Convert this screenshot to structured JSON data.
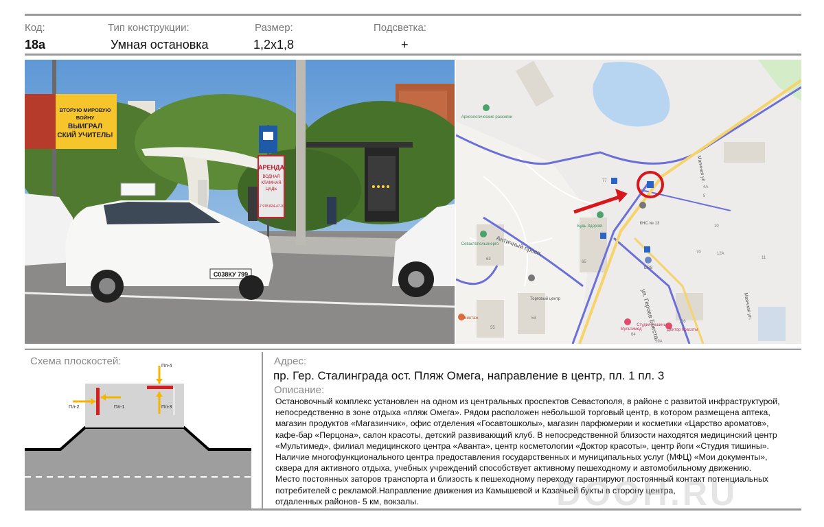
{
  "header": {
    "code_label": "Код:",
    "code_value": "18а",
    "type_label": "Тип конструкции:",
    "type_value": "Умная остановка",
    "size_label": "Размер:",
    "size_value": "1,2х1,8",
    "light_label": "Подсветка:",
    "light_value": "+"
  },
  "photo": {
    "billboard_lines": [
      "ВТОРУЮ МИРОВУЮ",
      "ВОЙНУ",
      "ВЫИГРАЛ",
      "СКИЙ УЧИТЕЛЬ!"
    ],
    "shelter_ad_lines": [
      "АРЕНДА",
      "ВОДНАЯ",
      "КЛАМНАЯ",
      "ЦАДЬ"
    ],
    "shelter_ad_phone": "+7 978 824-47-01",
    "plate_text": "С038КУ 799"
  },
  "map": {
    "street_1": "Античный просп.",
    "street_2": "ул. Героев Бреста",
    "street_3": "Маячная ул.",
    "street_4": "Маячная ул.",
    "poi_1": "Археологические раскопки",
    "poi_2": "Будь Здоров!",
    "poi_3": "КНС № 13",
    "poi_4": "Севастопольэнерго",
    "poi_5": "Торговый центр",
    "poi_6": "CRS",
    "poi_7": "Студия тишины",
    "poi_8": "Мультимед",
    "poi_9": "Доктор Красоты",
    "poi_10": "Винтаж",
    "num_1": "63",
    "num_2": "65",
    "num_3": "53",
    "num_4": "55",
    "num_5": "70",
    "num_6": "10",
    "num_7": "12А",
    "num_8": "11",
    "num_9": "116",
    "num_10": "64",
    "num_11": "59А",
    "num_12": "4А",
    "num_13": "5",
    "num_14": "77"
  },
  "scheme": {
    "title": "Схема плоскостей:",
    "pl1": "Пл-1",
    "pl2": "Пл-2",
    "pl3": "Пл-3",
    "pl4": "Пл-4"
  },
  "address": {
    "label": "Адрес:",
    "value": "пр. Гер. Сталинграда ост. Пляж Омега, направление в центр, пл. 1 пл. 3",
    "desc_label": "Описание:",
    "desc_lines": [
      "Остановочный комплекс установлен на одном из центральных проспектов Севастополя, в районе с развитой инфраструктурой,",
      "непосредственно в зоне отдыха  «пляж Омега». Рядом расположен небольшой торговый центр, в котором размещена аптека,",
      "магазин продуктов «Магазинчик», офис  отделения «Госавтошколы»,  магазин парфюмерии и косметики «Царство ароматов»,",
      "кафе-бар «Перцона», салон красоты, детский развивающий клуб. В непосредственной близости находятся медицинский центр",
      "«Мультимед», филиал медицинского центра «Аванта», центр косметологии «Доктор красоты», центр йоги «Студия тишины».",
      "Наличие многофункционального центра предоставления государственных и муниципальных услуг (МФЦ) «Мои документы»,",
      "сквера для активного отдыха,  учебных учреждений способствует активному пешеходному и автомобильному движению.",
      "Место постоянных заторов транспорта и близость к пешеходному переходу гарантируют постоянный контакт потенциальных",
      "потребителей с рекламой.Направление движения из Камышевой и Казачьей бухты в сторону центра,",
      "отдаленных районов-  5 км, вокзалы."
    ]
  },
  "watermark": "DOOH.RU"
}
